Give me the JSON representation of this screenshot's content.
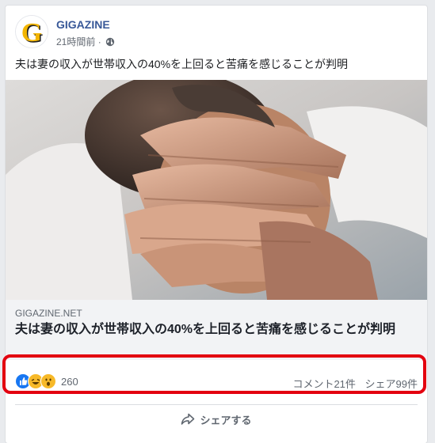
{
  "post": {
    "page_name": "GIGAZINE",
    "time": "21時間前",
    "time_separator": "·",
    "text": "夫は妻の収入が世帯収入の40%を上回ると苦痛を感じることが判明"
  },
  "link": {
    "domain": "GIGAZINE.NET",
    "title": "夫は妻の収入が世帯収入の40%を上回ると苦痛を感じることが判明"
  },
  "stats": {
    "reaction_count": "260",
    "comments": "コメント21件",
    "shares": "シェア99件",
    "reaction_icons": [
      "like-icon",
      "haha-icon",
      "wow-icon"
    ]
  },
  "actions": {
    "share_label": "シェアする"
  },
  "colors": {
    "brand_blue": "#385898",
    "highlight_red": "#e3000f",
    "like_blue": "#1877f2",
    "reaction_yellow": "#f7b928"
  }
}
